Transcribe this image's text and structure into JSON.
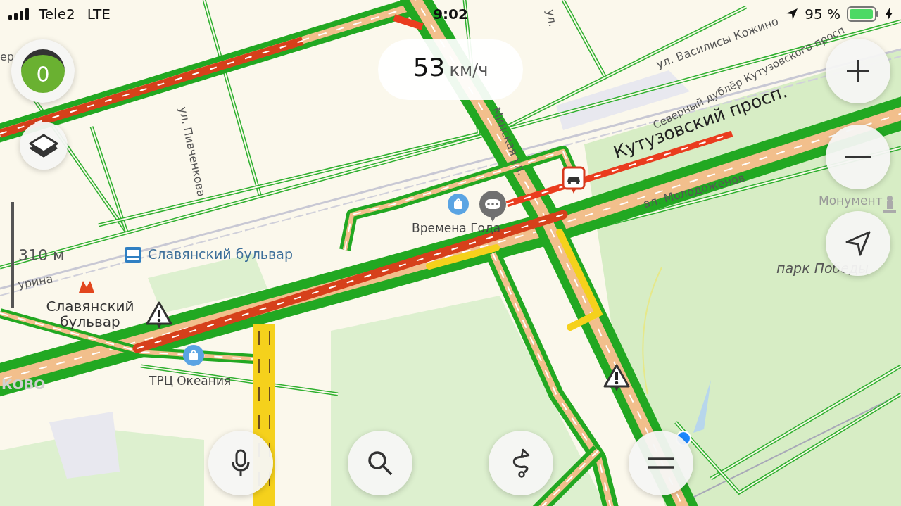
{
  "status_bar": {
    "carrier": "Tele2",
    "network": "LTE",
    "time": "9:02",
    "battery": "95 %"
  },
  "speed": {
    "value": "53",
    "unit": "км/ч"
  },
  "score": "0",
  "scale": "310 м",
  "map_labels": [
    {
      "text": "ер",
      "kind": "street"
    },
    {
      "text": "ул. Пивченкова",
      "kind": "street"
    },
    {
      "text": "Минская ул.",
      "kind": "street"
    },
    {
      "text": "ул.",
      "kind": "street"
    },
    {
      "text": "ул. Василисы Кожино",
      "kind": "street"
    },
    {
      "text": "Северный дублёр Кутузовского просп",
      "kind": "street"
    },
    {
      "text": "Кутузовский просп.",
      "kind": "avenue"
    },
    {
      "text": "ал. Молодожёнов",
      "kind": "street"
    },
    {
      "text": "Времена Года",
      "kind": "poi"
    },
    {
      "text": "Славянский бульвар",
      "kind": "transit"
    },
    {
      "text": "урина",
      "kind": "street"
    },
    {
      "text": "Славянский бульвар",
      "kind": "metro"
    },
    {
      "text": "ТРЦ Океания",
      "kind": "poi"
    },
    {
      "text": "Монумент",
      "kind": "faded"
    },
    {
      "text": "парк Победы",
      "kind": "park"
    },
    {
      "text": "КОВО",
      "kind": "district"
    }
  ]
}
